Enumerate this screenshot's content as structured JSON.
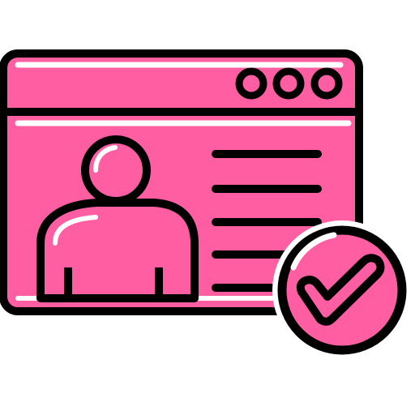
{
  "icon": {
    "name": "verified-user-profile-window-icon",
    "parts": {
      "window": "browser-window-icon",
      "window_controls": [
        "window-dot-icon",
        "window-dot-icon",
        "window-dot-icon"
      ],
      "avatar": "user-avatar-icon",
      "text_lines_count": 5,
      "badge": "checkmark-badge-icon"
    }
  },
  "colors": {
    "fill": "#ff5fa2",
    "stroke": "#000000",
    "highlight": "#ffffff",
    "background": "#ffffff"
  }
}
